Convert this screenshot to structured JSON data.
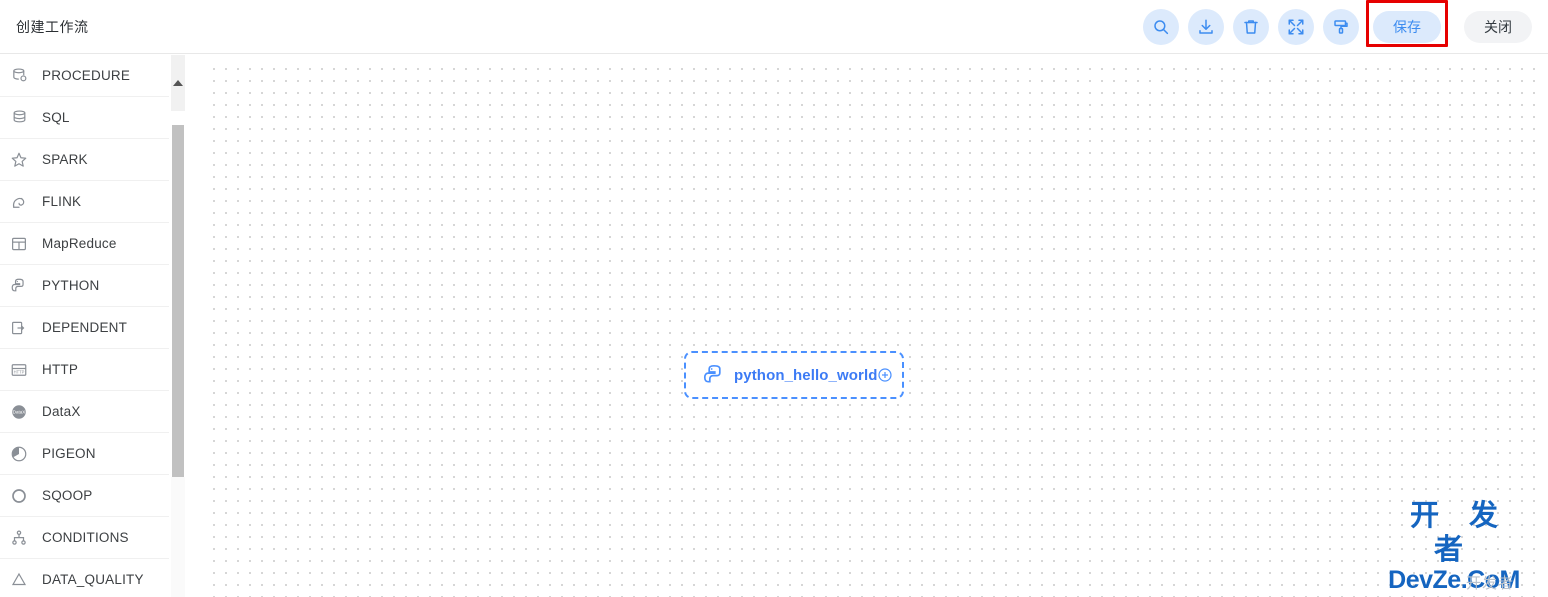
{
  "header": {
    "title": "创建工作流",
    "toolbar": {
      "icons": [
        {
          "name": "search-icon",
          "label": "搜索"
        },
        {
          "name": "download-icon",
          "label": "下载"
        },
        {
          "name": "delete-icon",
          "label": "删除"
        },
        {
          "name": "fullscreen-icon",
          "label": "全屏"
        },
        {
          "name": "format-icon",
          "label": "格式化"
        }
      ],
      "save_label": "保存",
      "close_label": "关闭"
    }
  },
  "sidebar": {
    "items": [
      {
        "label": "PROCEDURE",
        "icon": "database-procedure-icon"
      },
      {
        "label": "SQL",
        "icon": "database-sql-icon"
      },
      {
        "label": "SPARK",
        "icon": "spark-star-icon"
      },
      {
        "label": "FLINK",
        "icon": "flink-squirrel-icon"
      },
      {
        "label": "MapReduce",
        "icon": "mapreduce-icon"
      },
      {
        "label": "PYTHON",
        "icon": "python-icon"
      },
      {
        "label": "DEPENDENT",
        "icon": "dependent-icon"
      },
      {
        "label": "HTTP",
        "icon": "http-icon"
      },
      {
        "label": "DataX",
        "icon": "datax-icon"
      },
      {
        "label": "PIGEON",
        "icon": "pigeon-icon"
      },
      {
        "label": "SQOOP",
        "icon": "sqoop-circle-icon"
      },
      {
        "label": "CONDITIONS",
        "icon": "conditions-tree-icon"
      },
      {
        "label": "DATA_QUALITY",
        "icon": "data-quality-icon"
      }
    ]
  },
  "canvas": {
    "node": {
      "label": "python_hello_world",
      "icon": "python-icon",
      "add_icon": "plus-circle-icon"
    },
    "watermark": {
      "line1": "开 发 者",
      "line2": "DevZe.CoM",
      "ghost": "开发者"
    }
  },
  "colors": {
    "accent_blue": "#3c8cf0",
    "icon_button_bg": "#dceafc",
    "node_border": "#4a90ff",
    "highlight_red": "#e60000",
    "close_button_bg": "#f2f3f5"
  }
}
